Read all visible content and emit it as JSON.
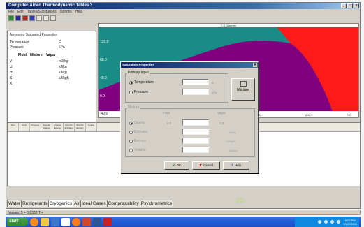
{
  "window": {
    "title": "Computer-Aided Thermodynamic Tables 3",
    "controls": [
      "_",
      "□",
      "x"
    ]
  },
  "menu": [
    "File",
    "Edit",
    "Tables/Substances",
    "Options",
    "Help"
  ],
  "left_panel": {
    "title": "Ammonia Saturated Properties",
    "rows_top": [
      {
        "label": "Temperature",
        "unit": "C"
      },
      {
        "label": "Pressure",
        "unit": "kPa"
      }
    ],
    "headers": [
      "Fluid",
      "Mixture",
      "Vapor"
    ],
    "rows_props": [
      {
        "label": "V",
        "unit": "m3/kg"
      },
      {
        "label": "U",
        "unit": "kJ/kg"
      },
      {
        "label": "H",
        "unit": "kJ/kg"
      },
      {
        "label": "S",
        "unit": "kJ/kgK"
      },
      {
        "label": "X",
        "unit": ""
      }
    ]
  },
  "chart": {
    "title": "T-S Diagram",
    "y_ticks": [
      "120.0",
      "80.0",
      "40.0",
      "0.0",
      "-40.0"
    ],
    "x_ticks": [
      "2.0",
      "4.0",
      "5.01",
      "6.02",
      "7.0"
    ],
    "colors": {
      "teal": "#1a8c86",
      "purple": "#800080",
      "red": "#ff1a1a"
    }
  },
  "table": {
    "headers": [
      "Type",
      "Temp",
      "Pressure",
      "Specific Volume",
      "Internal Energy",
      "Specific Enthalpy",
      "Specific Entropy",
      "Quality"
    ]
  },
  "dialog": {
    "title": "Saturation Properties",
    "close": "X",
    "primary_group": "Primary Input",
    "temperature_label": "Temperature",
    "pressure_label": "Pressure",
    "temp_unit": "C",
    "pressure_unit": "kPa",
    "mixture_button": "Mixture",
    "mixture_group": "Mixture",
    "fluid_header": "Fluid",
    "vapor_header": "Vapor",
    "quality_label": "Quality",
    "enthalpy_label": "Enthalpy",
    "entropy_label": "Entropy",
    "volume_label": "Volume",
    "fluid_quality": "0.0",
    "vapor_quality": "1.0",
    "enthalpy_unit": "kJ/kg",
    "entropy_unit": "kJ/kg/K",
    "volume_unit": "m3/kg",
    "ok": "OK",
    "cancel": "Cancel",
    "help": "Help"
  },
  "tabs": [
    "Water",
    "Refrigerants",
    "Cryogenics",
    "Air",
    "Ideal Gases",
    "Compressibility",
    "Psychrometrics"
  ],
  "active_tab": "Cryogenics",
  "status": "Values: 5 = 0.0333 T = ",
  "page_number": "25",
  "taskbar": {
    "start": "start",
    "clock_time": "8:23 PM",
    "clock_date": "10/17/2011"
  }
}
